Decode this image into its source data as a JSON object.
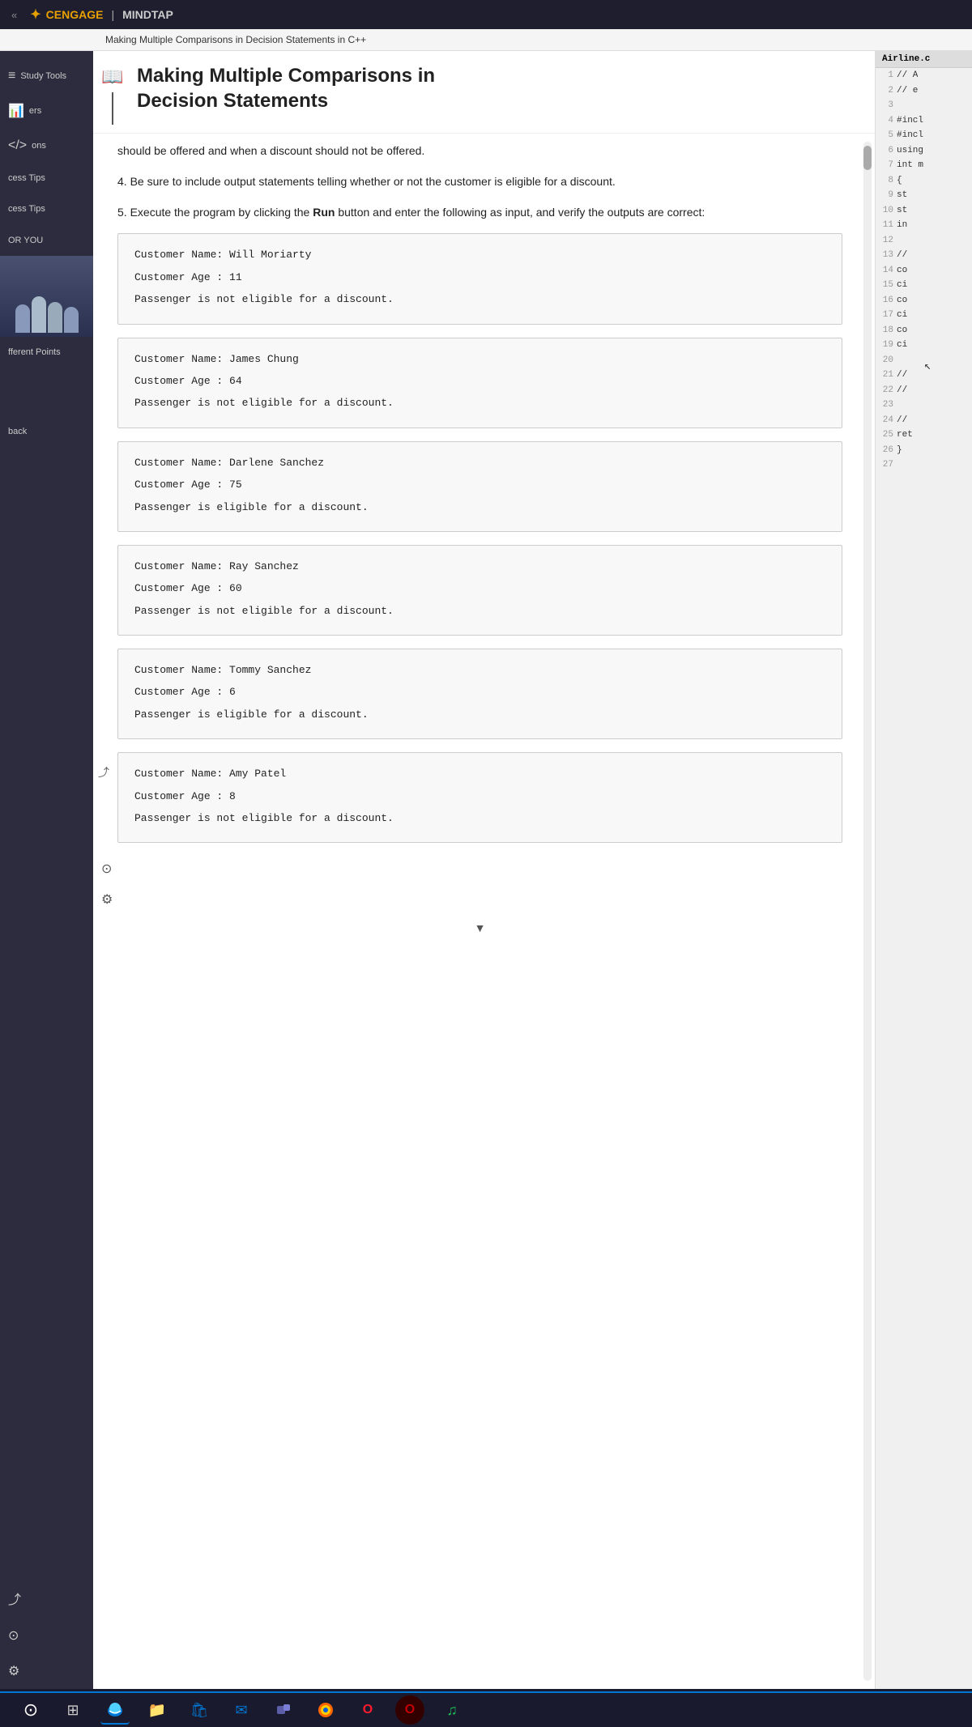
{
  "topbar": {
    "arrows": "«",
    "brand": "CENGAGE",
    "separator": "|",
    "mindtap": "MINDTAP"
  },
  "breadcrumb": "Making Multiple Comparisons in Decision Statements in C++",
  "content": {
    "title_line1": "Making Multiple Comparisons in",
    "title_line2": "Decision Statements",
    "step3_text": "should be offered and when a discount should not be offered.",
    "step4_text": "4. Be sure to include output statements telling whether or not the customer is eligible for a discount.",
    "step5_text_a": "5. Execute the program by clicking the ",
    "step5_run": "Run",
    "step5_text_b": " button and enter the following as input, and verify the outputs are correct:"
  },
  "outputs": [
    {
      "name": "Will Moriarty",
      "age": "11",
      "result": "not eligible for a discount."
    },
    {
      "name": "James Chung",
      "age": "64",
      "result": "not eligible for a discount."
    },
    {
      "name": "Darlene Sanchez",
      "age": "75",
      "result": "eligible for a discount."
    },
    {
      "name": "Ray Sanchez",
      "age": "60",
      "result": "not eligible for a discount."
    },
    {
      "name": "Tommy Sanchez",
      "age": "6",
      "result": "eligible for a discount."
    },
    {
      "name": "Amy Patel",
      "age": "8",
      "result": "not eligible for a discount."
    }
  ],
  "sidebar": {
    "items": [
      {
        "label": "Study Tools",
        "icon": "≡"
      },
      {
        "label": "ers",
        "icon": "📊"
      },
      {
        "label": "ons",
        "icon": "</>"
      },
      {
        "label": "cess Tips",
        "icon": ""
      },
      {
        "label": "cess Tips",
        "icon": ""
      },
      {
        "label": "OR YOU",
        "icon": ""
      },
      {
        "label": "fferent Points",
        "icon": ""
      },
      {
        "label": "back",
        "icon": ""
      }
    ],
    "bottom_icons": [
      "share",
      "help",
      "settings"
    ]
  },
  "code_panel": {
    "title": "Airline.c",
    "lines": [
      {
        "num": "1",
        "text": "// A"
      },
      {
        "num": "2",
        "text": "// e"
      },
      {
        "num": "3",
        "text": ""
      },
      {
        "num": "4",
        "text": "#incl"
      },
      {
        "num": "5",
        "text": "#incl"
      },
      {
        "num": "6",
        "text": "using"
      },
      {
        "num": "7",
        "text": "int m"
      },
      {
        "num": "8",
        "text": "{"
      },
      {
        "num": "9",
        "text": "  st"
      },
      {
        "num": "10",
        "text": "  st"
      },
      {
        "num": "11",
        "text": "  in"
      },
      {
        "num": "12",
        "text": ""
      },
      {
        "num": "13",
        "text": "  //"
      },
      {
        "num": "14",
        "text": "  co"
      },
      {
        "num": "15",
        "text": "  ci"
      },
      {
        "num": "16",
        "text": "  co"
      },
      {
        "num": "17",
        "text": "  ci"
      },
      {
        "num": "18",
        "text": "  co"
      },
      {
        "num": "19",
        "text": "  ci"
      },
      {
        "num": "20",
        "text": ""
      },
      {
        "num": "21",
        "text": "  //"
      },
      {
        "num": "22",
        "text": "  //"
      },
      {
        "num": "23",
        "text": ""
      },
      {
        "num": "24",
        "text": "  //"
      },
      {
        "num": "25",
        "text": "  ret"
      },
      {
        "num": "26",
        "text": "}"
      },
      {
        "num": "27",
        "text": ""
      }
    ]
  },
  "taskbar": {
    "buttons": [
      {
        "label": "⊙",
        "name": "windows-button",
        "color": "#fff"
      },
      {
        "label": "⊞",
        "name": "task-view",
        "color": "#aaa"
      },
      {
        "label": "◉",
        "name": "edge-browser",
        "color": "#0078d4"
      },
      {
        "label": "📁",
        "name": "file-explorer",
        "color": "#e8a000"
      },
      {
        "label": "🏪",
        "name": "microsoft-store",
        "color": "#0078d4"
      },
      {
        "label": "✉",
        "name": "mail-app",
        "color": "#0078d4"
      },
      {
        "label": "✦",
        "name": "teams-app",
        "color": "#5b5ea6"
      },
      {
        "label": "🦊",
        "name": "firefox-browser",
        "color": "#ff6600"
      },
      {
        "label": "O",
        "name": "opera-browser",
        "color": "#ff1b2d"
      },
      {
        "label": "O",
        "name": "opera-gx-browser",
        "color": "#c40000"
      },
      {
        "label": "♫",
        "name": "spotify-app",
        "color": "#1db954"
      }
    ]
  }
}
